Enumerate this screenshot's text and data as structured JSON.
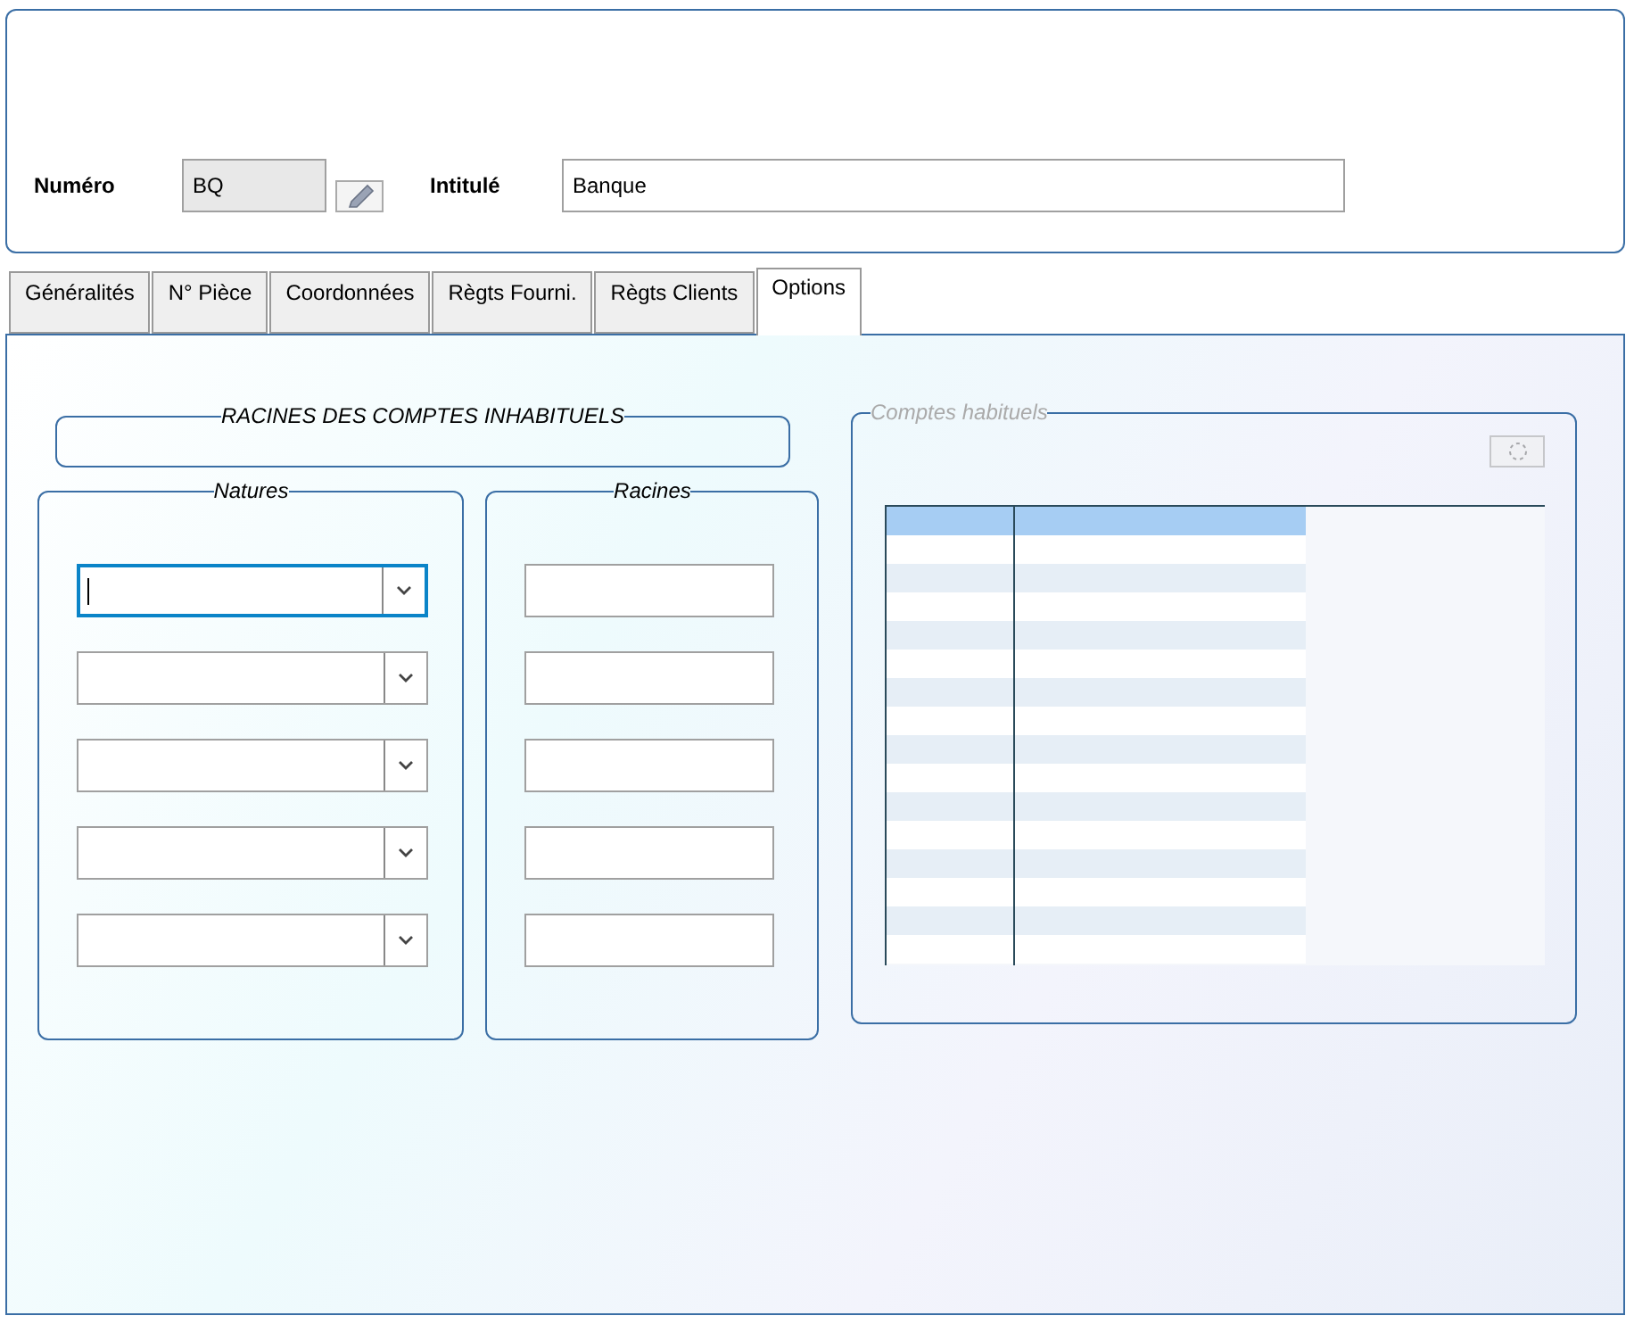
{
  "header": {
    "numero_label": "Numéro",
    "numero_value": "BQ",
    "intitule_label": "Intitulé",
    "intitule_value": "Banque"
  },
  "tabs": [
    {
      "label": "Généralités",
      "selected": false
    },
    {
      "label": "N° Pièce",
      "selected": false
    },
    {
      "label": "Coordonnées",
      "selected": false
    },
    {
      "label": "Règts Fourni.",
      "selected": false
    },
    {
      "label": "Règts Clients",
      "selected": false
    },
    {
      "label": "Options",
      "selected": true
    }
  ],
  "racines_title": "RACINES DES COMPTES INHABITUELS",
  "natures": {
    "legend": "Natures",
    "combos": [
      {
        "focused": true
      },
      {
        "focused": false
      },
      {
        "focused": false
      },
      {
        "focused": false
      },
      {
        "focused": false
      }
    ]
  },
  "racines": {
    "legend": "Racines",
    "fields": [
      {
        "focused": false
      },
      {
        "focused": false
      },
      {
        "focused": false
      },
      {
        "focused": false
      },
      {
        "focused": false
      }
    ]
  },
  "comptes": {
    "legend": "Comptes habituels",
    "disabled": true
  }
}
